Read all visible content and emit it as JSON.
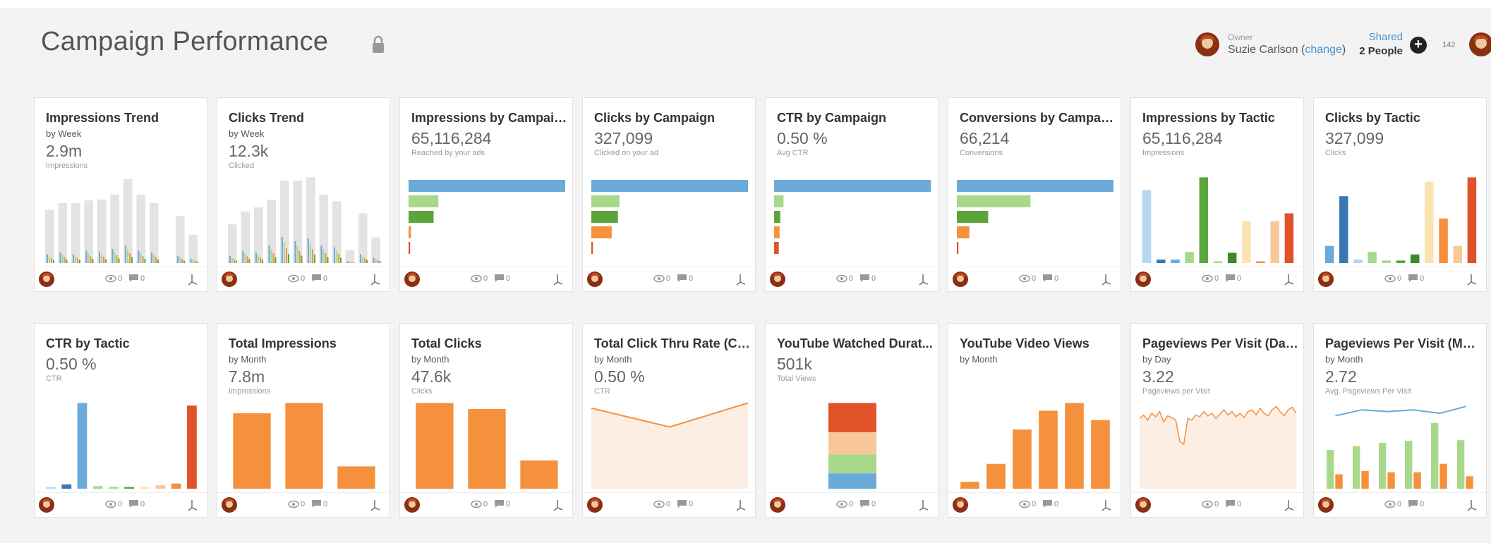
{
  "header": {
    "title": "Campaign Performance",
    "owner_label": "Owner",
    "owner_name": "Suzie Carlson",
    "owner_change": "change",
    "shared_label": "Shared",
    "shared_people": "2 People",
    "badge_count": "142"
  },
  "colors": {
    "blue": "#6aaad8",
    "dark_blue": "#3a78b4",
    "light_blue": "#b5d6ee",
    "light_green": "#a8d98a",
    "green": "#5aa63c",
    "dark_green": "#3c8a2a",
    "orange": "#f5903c",
    "light_orange": "#f8c89a",
    "peach": "#fbe3b0",
    "red": "#e0522a",
    "gray": "#e3e3e3"
  },
  "tiles": [
    {
      "title": "Impressions Trend",
      "sub": "by Week",
      "value": "2.9m",
      "caption": "Impressions",
      "views": "0",
      "comments": "0"
    },
    {
      "title": "Clicks Trend",
      "sub": "by Week",
      "value": "12.3k",
      "caption": "Clicked",
      "views": "0",
      "comments": "0"
    },
    {
      "title": "Impressions by Campaign",
      "sub": "",
      "value": "65,116,284",
      "caption": "Reached by your ads",
      "views": "0",
      "comments": "0"
    },
    {
      "title": "Clicks by Campaign",
      "sub": "",
      "value": "327,099",
      "caption": "Clicked on your ad",
      "views": "0",
      "comments": "0"
    },
    {
      "title": "CTR by Campaign",
      "sub": "",
      "value": "0.50 %",
      "caption": "Avg CTR",
      "views": "0",
      "comments": "0"
    },
    {
      "title": "Conversions by Campaign",
      "sub": "",
      "value": "66,214",
      "caption": "Conversions",
      "views": "0",
      "comments": "0"
    },
    {
      "title": "Impressions by Tactic",
      "sub": "",
      "value": "65,116,284",
      "caption": "Impressions",
      "views": "0",
      "comments": "0"
    },
    {
      "title": "Clicks by Tactic",
      "sub": "",
      "value": "327,099",
      "caption": "Clicks",
      "views": "0",
      "comments": "0"
    },
    {
      "title": "CTR by Tactic",
      "sub": "",
      "value": "0.50 %",
      "caption": "CTR",
      "views": "0",
      "comments": "0"
    },
    {
      "title": "Total Impressions",
      "sub": "by Month",
      "value": "7.8m",
      "caption": "Impressions",
      "views": "0",
      "comments": "0"
    },
    {
      "title": "Total Clicks",
      "sub": "by Month",
      "value": "47.6k",
      "caption": "Clicks",
      "views": "0",
      "comments": "0"
    },
    {
      "title": "Total Click Thru Rate (CTR)",
      "sub": "by Month",
      "value": "0.50 %",
      "caption": "CTR",
      "views": "0",
      "comments": "0"
    },
    {
      "title": "YouTube Watched Durat...",
      "sub": "",
      "value": "501k",
      "caption": "Total Views",
      "views": "0",
      "comments": "0"
    },
    {
      "title": "YouTube Video Views",
      "sub": "by Month",
      "value": "",
      "caption": "",
      "views": "0",
      "comments": "0"
    },
    {
      "title": "Pageviews Per Visit (Daily)",
      "sub": "by Day",
      "value": "3.22",
      "caption": "Pageviews per Visit",
      "views": "0",
      "comments": "0"
    },
    {
      "title": "Pageviews Per Visit (Mon...",
      "sub": "by Month",
      "value": "2.72",
      "caption": "Avg. Pageviews Per Visit",
      "views": "0",
      "comments": "0"
    }
  ],
  "chart_data": [
    {
      "type": "bar",
      "title": "Impressions Trend",
      "series": [
        {
          "values": [
            0.62,
            0.7,
            0.7,
            0.73,
            0.74,
            0.8,
            0.98,
            0.8,
            0.7,
            0.0,
            0.55,
            0.33
          ]
        },
        {
          "values": [
            0.1,
            0.12,
            0.1,
            0.14,
            0.13,
            0.16,
            0.2,
            0.14,
            0.12,
            0.0,
            0.08,
            0.05
          ]
        }
      ]
    },
    {
      "type": "bar",
      "title": "Clicks Trend",
      "series": [
        {
          "values": [
            0.45,
            0.6,
            0.65,
            0.74,
            0.96,
            0.96,
            1.0,
            0.8,
            0.72,
            0.15,
            0.58,
            0.3
          ]
        },
        {
          "values": [
            0.08,
            0.14,
            0.12,
            0.2,
            0.3,
            0.25,
            0.28,
            0.2,
            0.18,
            0.02,
            0.1,
            0.06
          ]
        }
      ]
    },
    {
      "type": "bar",
      "orientation": "horizontal",
      "title": "Impressions by Campaign",
      "values": [
        1.0,
        0.19,
        0.16,
        0.015,
        0.01
      ]
    },
    {
      "type": "bar",
      "orientation": "horizontal",
      "title": "Clicks by Campaign",
      "values": [
        1.0,
        0.18,
        0.17,
        0.13,
        0.01
      ]
    },
    {
      "type": "bar",
      "orientation": "horizontal",
      "title": "CTR by Campaign",
      "values": [
        1.0,
        0.06,
        0.04,
        0.035,
        0.03
      ]
    },
    {
      "type": "bar",
      "orientation": "horizontal",
      "title": "Conversions by Campaign",
      "values": [
        1.0,
        0.47,
        0.2,
        0.08,
        0.01
      ]
    },
    {
      "type": "bar",
      "title": "Impressions by Tactic",
      "values": [
        0.85,
        0.04,
        0.04,
        0.13,
        1.0,
        0.02,
        0.12,
        0.49,
        0.02,
        0.49,
        0.58
      ]
    },
    {
      "type": "bar",
      "title": "Clicks by Tactic",
      "values": [
        0.2,
        0.78,
        0.04,
        0.13,
        0.03,
        0.03,
        0.1,
        0.95,
        0.52,
        0.2,
        1.0
      ]
    },
    {
      "type": "bar",
      "title": "CTR by Tactic",
      "values": [
        0.01,
        0.05,
        1.0,
        0.03,
        0.02,
        0.02,
        0.02,
        0.04,
        0.06,
        0.97
      ]
    },
    {
      "type": "bar",
      "title": "Total Impressions",
      "values": [
        0.88,
        1.0,
        0.26
      ]
    },
    {
      "type": "bar",
      "title": "Total Clicks",
      "values": [
        1.0,
        0.93,
        0.33
      ]
    },
    {
      "type": "area",
      "title": "Total Click Thru Rate (CTR)",
      "values": [
        0.94,
        0.72,
        1.0
      ]
    },
    {
      "type": "bar",
      "stacked": true,
      "title": "YouTube Watched Durat...",
      "values": [
        0.18,
        0.22,
        0.26,
        0.34
      ]
    },
    {
      "type": "bar",
      "title": "YouTube Video Views",
      "values": [
        0.08,
        0.29,
        0.69,
        0.91,
        1.0,
        0.8
      ]
    },
    {
      "type": "line",
      "title": "Pageviews Per Visit (Daily)",
      "values": [
        0.82,
        0.86,
        0.8,
        0.88,
        0.84,
        0.9,
        0.78,
        0.85,
        0.83,
        0.8,
        0.55,
        0.52,
        0.82,
        0.8,
        0.86,
        0.84,
        0.9,
        0.85,
        0.88,
        0.82,
        0.87,
        0.92,
        0.86,
        0.9,
        0.84,
        0.88,
        0.83,
        0.9,
        0.92,
        0.86,
        0.94,
        0.88,
        0.85,
        0.92,
        0.96,
        0.9,
        0.85,
        0.92,
        0.95,
        0.88
      ]
    },
    {
      "type": "bar",
      "title": "Pageviews Per Visit (Mon...",
      "series": [
        {
          "values": [
            0.59,
            0.65,
            0.7,
            0.73,
            1.0,
            0.74
          ]
        },
        {
          "values": [
            0.22,
            0.27,
            0.25,
            0.25,
            0.38,
            0.19
          ]
        }
      ],
      "line": [
        0.85,
        0.92,
        0.9,
        0.92,
        0.88,
        0.96
      ]
    }
  ]
}
